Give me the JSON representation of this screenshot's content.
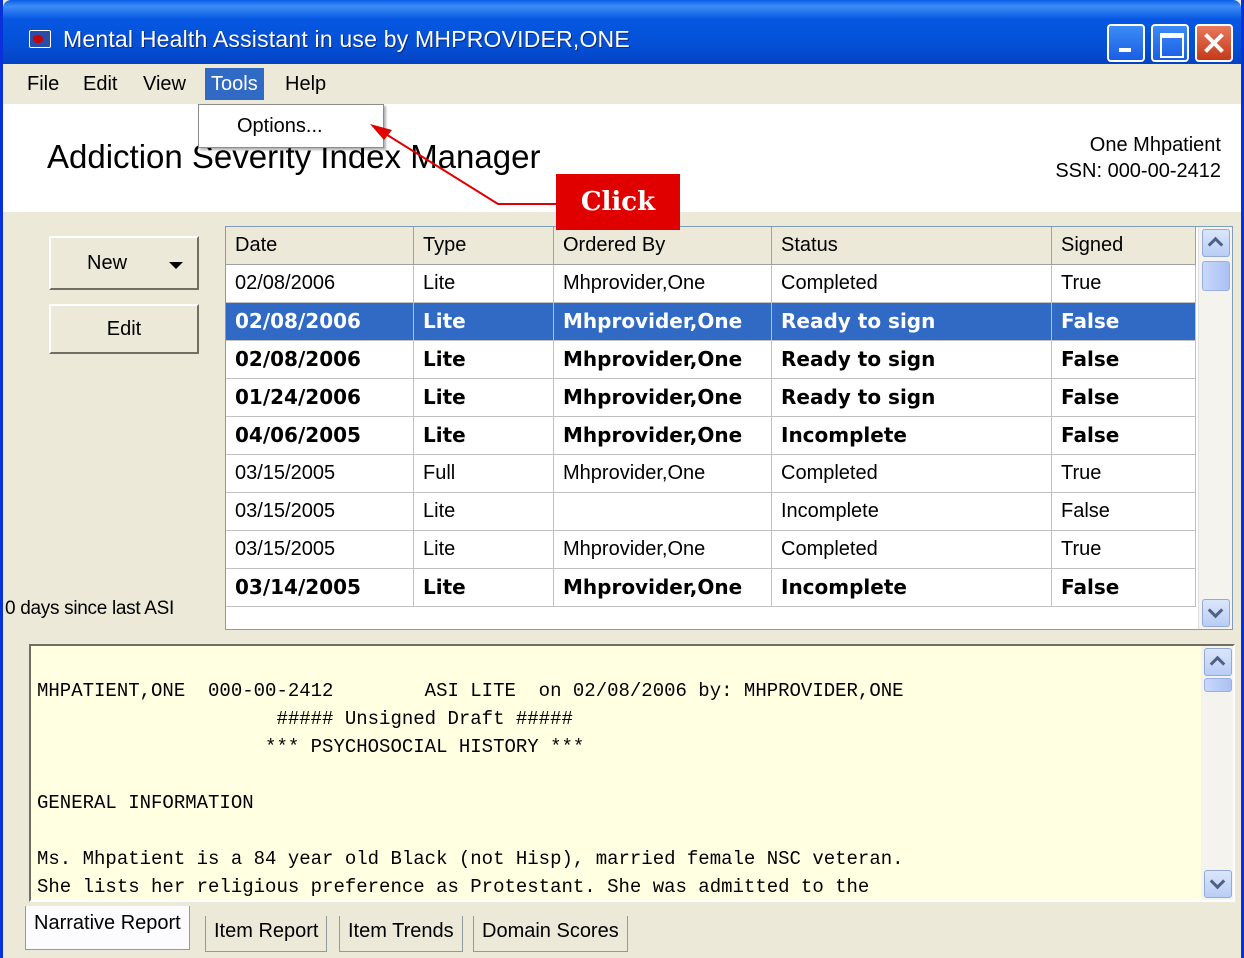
{
  "window": {
    "title": "Mental Health Assistant in use by MHPROVIDER,ONE"
  },
  "menu": {
    "items": [
      {
        "label": "File"
      },
      {
        "label": "Edit"
      },
      {
        "label": "View"
      },
      {
        "label": "Tools"
      },
      {
        "label": "Help"
      }
    ],
    "active": "Tools",
    "dropdown": {
      "items": [
        {
          "label": "Options..."
        }
      ]
    }
  },
  "header": {
    "title": "Addiction Severity Index Manager",
    "patient_name": "One Mhpatient",
    "patient_ssn": "SSN: 000-00-2412"
  },
  "annotation": {
    "label": "Click",
    "color": "#e00000"
  },
  "left_panel": {
    "new_button": "New",
    "edit_button": "Edit",
    "days_label": "0 days since last ASI"
  },
  "grid": {
    "columns": [
      "Date",
      "Type",
      "Ordered By",
      "Status",
      "Signed"
    ],
    "rows": [
      {
        "cells": [
          "02/08/2006",
          "Lite",
          "Mhprovider,One",
          "Completed",
          "True"
        ],
        "bold": false,
        "selected": false
      },
      {
        "cells": [
          "02/08/2006",
          "Lite",
          "Mhprovider,One",
          "Ready to sign",
          "False"
        ],
        "bold": true,
        "selected": true
      },
      {
        "cells": [
          "02/08/2006",
          "Lite",
          "Mhprovider,One",
          "Ready to sign",
          "False"
        ],
        "bold": true,
        "selected": false
      },
      {
        "cells": [
          "01/24/2006",
          "Lite",
          "Mhprovider,One",
          "Ready to sign",
          "False"
        ],
        "bold": true,
        "selected": false
      },
      {
        "cells": [
          "04/06/2005",
          "Lite",
          "Mhprovider,One",
          "Incomplete",
          "False"
        ],
        "bold": true,
        "selected": false
      },
      {
        "cells": [
          "03/15/2005",
          "Full",
          "Mhprovider,One",
          "Completed",
          "True"
        ],
        "bold": false,
        "selected": false
      },
      {
        "cells": [
          "03/15/2005",
          "Lite",
          "",
          "Incomplete",
          "False"
        ],
        "bold": false,
        "selected": false
      },
      {
        "cells": [
          "03/15/2005",
          "Lite",
          "Mhprovider,One",
          "Completed",
          "True"
        ],
        "bold": false,
        "selected": false
      },
      {
        "cells": [
          "03/14/2005",
          "Lite",
          "Mhprovider,One",
          "Incomplete",
          "False"
        ],
        "bold": true,
        "selected": false
      }
    ],
    "selection_color": "#316ac5"
  },
  "report": {
    "lines": [
      "MHPATIENT,ONE  000-00-2412        ASI LITE  on 02/08/2006 by: MHPROVIDER,ONE",
      "                     ##### Unsigned Draft #####",
      "                    *** PSYCHOSOCIAL HISTORY ***",
      "",
      "GENERAL INFORMATION",
      "",
      "Ms. Mhpatient is a 84 year old Black (not Hisp), married female NSC veteran.",
      "She lists her religious preference as Protestant. She was admitted to the"
    ],
    "background": "#ffffe1"
  },
  "tabs": {
    "items": [
      {
        "label": "Narrative Report"
      },
      {
        "label": "Item Report"
      },
      {
        "label": "Item Trends"
      },
      {
        "label": "Domain Scores"
      }
    ],
    "active": "Narrative Report"
  }
}
